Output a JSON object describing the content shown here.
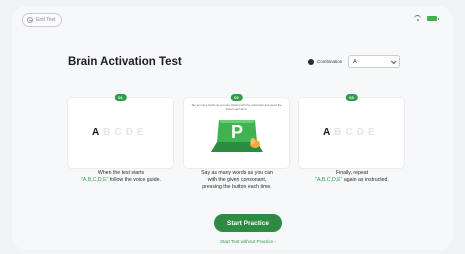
{
  "header": {
    "end_test_label": "End Test"
  },
  "page": {
    "title": "Brain Activation Test"
  },
  "combination": {
    "label": "Combination",
    "selected": "A"
  },
  "steps": [
    {
      "badge": "01",
      "letters": {
        "active": "A",
        "inactive": [
          "B",
          "C",
          "D",
          "E"
        ]
      },
      "caption_line1": "When the test starts",
      "caption_line2_green": "\"A,B,C,D,E\"",
      "caption_line2_rest": " follow the voice guide."
    },
    {
      "badge": "02",
      "instruction": "Tap as many words as you can starting with the consonant and press the button each time.",
      "key_letter": "P",
      "caption_line1": "Say as many words as you can",
      "caption_line2": "with the given consonant,",
      "caption_line3": "pressing the button each time."
    },
    {
      "badge": "03",
      "letters": {
        "active": "A",
        "inactive": [
          "B",
          "C",
          "D",
          "E"
        ]
      },
      "caption_line1": "Finally, repeat",
      "caption_line2_green": "\"A,B,C,D,E\"",
      "caption_line2_rest": " again as instructed."
    }
  ],
  "actions": {
    "start_practice": "Start Practice",
    "start_without_practice": "Start Test without Practice  ›"
  },
  "colors": {
    "accent_green": "#2f9e4c",
    "button_green": "#2f8a44"
  },
  "icons": [
    "exit-icon",
    "wifi-icon",
    "battery-icon",
    "combination-icon",
    "chevron-down-icon",
    "p-key-icon"
  ]
}
